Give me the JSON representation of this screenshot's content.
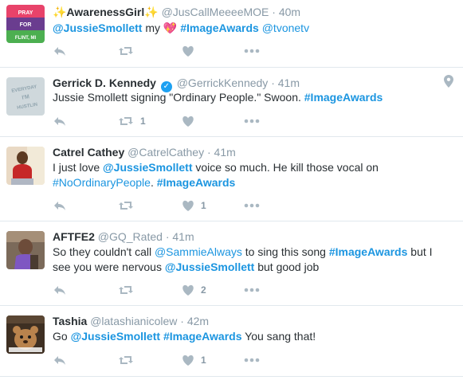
{
  "tweets": [
    {
      "name": "✨AwarenessGirl✨",
      "handle": "@JusCallMeeeeMOE",
      "time": "40m",
      "avatar_text": [
        "PRAY",
        "FOR",
        "FLINT, MI"
      ],
      "text": {
        "m1": "@JussieSmollett",
        "t1": " my ",
        "heart": "💖",
        "t2": " ",
        "h1": "#ImageAwards",
        "t3": " ",
        "l1": "@tvonetv"
      },
      "retweets": "",
      "likes": ""
    },
    {
      "name": "Gerrick D. Kennedy",
      "verified": "✓",
      "handle": "@GerrickKennedy",
      "time": "41m",
      "avatar_text": [
        "EVERYDAY",
        "I'M",
        "HUSTLIN"
      ],
      "text": {
        "t1": "Jussie Smollett signing \"Ordinary People.\" Swoon. ",
        "h1": "#ImageAwards"
      },
      "retweets": "1",
      "likes": ""
    },
    {
      "name": "Catrel Cathey",
      "handle": "@CatrelCathey",
      "time": "41m",
      "text": {
        "t1": "I just love ",
        "m1": "@JussieSmollett",
        "t2": " voice so much. He kill those vocal on",
        "l1": "#NoOrdinaryPeople",
        "t3": ". ",
        "h1": "#ImageAwards"
      },
      "retweets": "",
      "likes": "1"
    },
    {
      "name": "AFTFE2",
      "handle": "@GQ_Rated",
      "time": "41m",
      "text": {
        "t1": "So they couldn't call ",
        "l1": "@SammieAlways",
        "t2": " to sing this song ",
        "h1": "#ImageAwards",
        "t3": " but I",
        "t4": "see you were nervous ",
        "m1": "@JussieSmollett",
        "t5": " but good job"
      },
      "retweets": "",
      "likes": "2"
    },
    {
      "name": "Tashia",
      "handle": "@latashianicolew",
      "time": "42m",
      "text": {
        "t1": "Go ",
        "m1": "@JussieSmollett",
        "t2": " ",
        "h1": "#ImageAwards",
        "t3": " You sang that!"
      },
      "retweets": "",
      "likes": "1"
    }
  ],
  "separator": "·",
  "colors": {
    "link": "#1b95e0",
    "muted": "#8899a6",
    "icon": "#aab8c2",
    "border": "#e1e8ed"
  }
}
